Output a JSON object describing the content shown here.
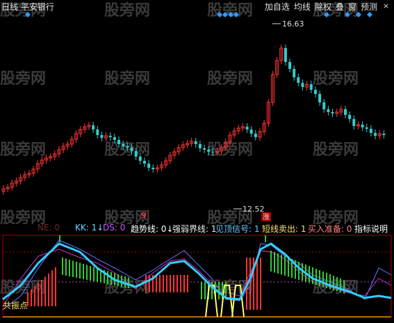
{
  "header": {
    "title": "日线 平安银行",
    "menu": [
      "加自选",
      "均线",
      "除权",
      "叠",
      "窗",
      "预测"
    ],
    "close": "×"
  },
  "price_chart": {
    "high_label": "16.63",
    "low_label": "12.52",
    "limit_up_badge": "涨",
    "marker_9": "9",
    "watermark": "股旁网"
  },
  "indicator_bar": {
    "items": [
      {
        "text": "NE: 0",
        "color": "#6a2a2a"
      },
      {
        "text": "KK: 1↓",
        "color": "#6fd4ff"
      },
      {
        "text": "DS: 0",
        "color": "#cc55ff"
      },
      {
        "text": "趋势线: 0↓",
        "color": "#ffffff"
      },
      {
        "text": "强弱界线: 1",
        "color": "#f0f0f0"
      },
      {
        "text": "见顶信号: 1",
        "color": "#66ccff"
      },
      {
        "text": "短线卖出: 1",
        "color": "#ffe066"
      },
      {
        "text": "买入准备: 0",
        "color": "#ff8080"
      },
      {
        "text": "指标说明",
        "color": "#ffffff"
      }
    ]
  },
  "indicator": {
    "resonance_label": "共振点"
  },
  "colors": {
    "up": "#ff3333",
    "down": "#33cccc",
    "diamond": "#3399ff",
    "kk": "#33ccff",
    "ds": "#cc33cc",
    "trend": "#6677ff",
    "signal": "#ffff66",
    "green_bar": "#33cc33"
  },
  "chart_data": {
    "type": "candlestick",
    "high": 16.63,
    "low": 12.52
  }
}
